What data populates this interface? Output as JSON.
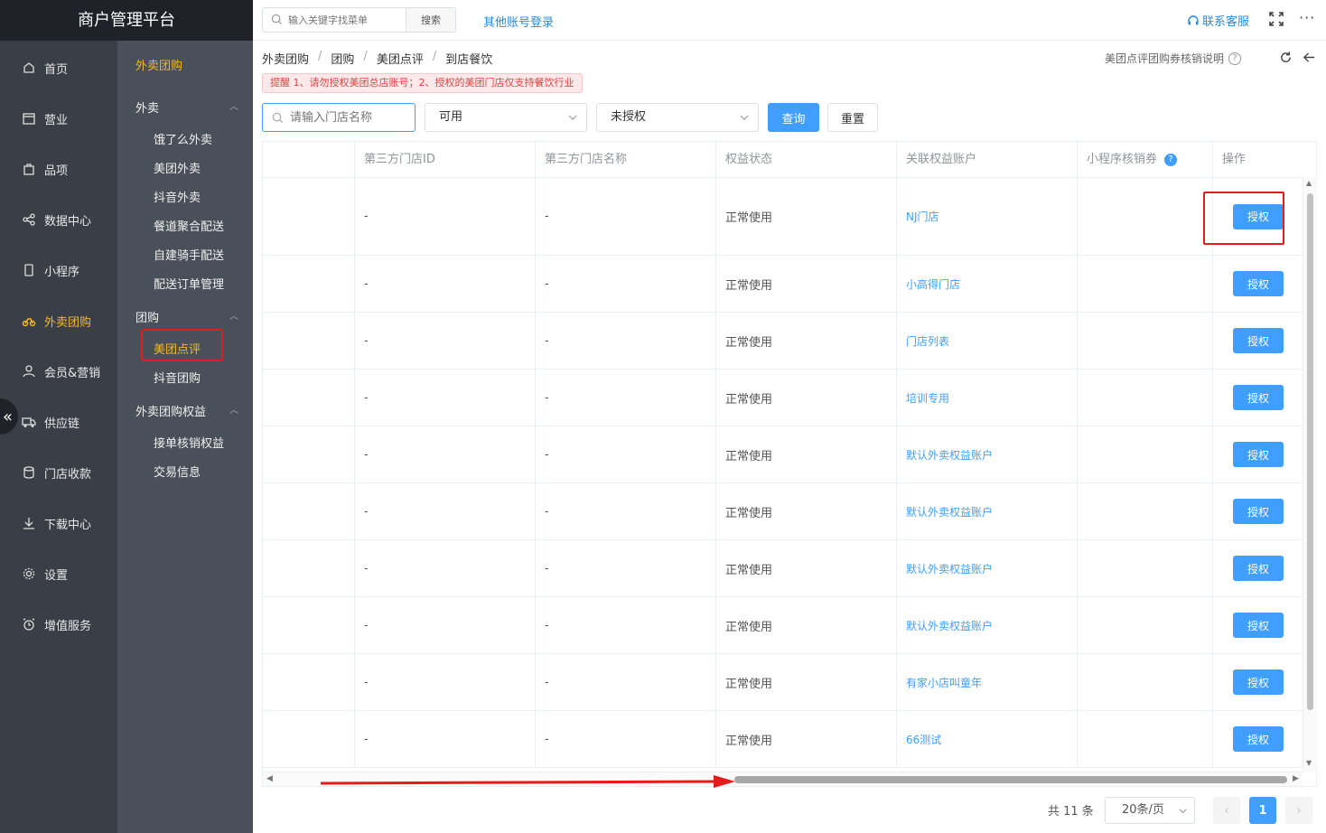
{
  "app": {
    "title": "商户管理平台"
  },
  "main_nav": [
    {
      "label": "首页",
      "icon": "home-icon"
    },
    {
      "label": "营业",
      "icon": "calendar-icon"
    },
    {
      "label": "品项",
      "icon": "bag-icon"
    },
    {
      "label": "数据中心",
      "icon": "share-icon"
    },
    {
      "label": "小程序",
      "icon": "phone-icon"
    },
    {
      "label": "外卖团购",
      "icon": "bike-icon",
      "active": true
    },
    {
      "label": "会员&营销",
      "icon": "user-icon"
    },
    {
      "label": "供应链",
      "icon": "truck-icon"
    },
    {
      "label": "门店收款",
      "icon": "coins-icon"
    },
    {
      "label": "下载中心",
      "icon": "download-icon"
    },
    {
      "label": "设置",
      "icon": "gear-icon"
    },
    {
      "label": "增值服务",
      "icon": "alarm-icon"
    }
  ],
  "sub_nav": {
    "title": "外卖团购",
    "group_waimai": "外卖",
    "waimai_items": [
      "饿了么外卖",
      "美团外卖",
      "抖音外卖",
      "餐道聚合配送",
      "自建骑手配送",
      "配送订单管理"
    ],
    "group_tuangou": "团购",
    "tuangou_items": [
      "美团点评",
      "抖音团购"
    ],
    "group_quanyi": "外卖团购权益",
    "quanyi_items": [
      "接单核销权益",
      "交易信息"
    ]
  },
  "topbar": {
    "search_placeholder": "输入关键字找菜单",
    "search_button": "搜索",
    "other_login": "其他账号登录",
    "contact": "联系客服",
    "more": "···"
  },
  "breadcrumb": [
    "外卖团购",
    "团购",
    "美团点评",
    "到店餐饮"
  ],
  "explain_link": "美团点评团购券核销说明",
  "notice": "提醒 1、请勿授权美团总店账号；2、授权的美团门店仅支持餐饮行业",
  "filters": {
    "store_placeholder": "请输入门店名称",
    "status_value": "可用",
    "auth_value": "未授权",
    "query_button": "查询",
    "reset_button": "重置"
  },
  "table": {
    "columns": [
      "",
      "第三方门店ID",
      "第三方门店名称",
      "权益状态",
      "关联权益账户",
      "小程序核销券",
      "操作"
    ],
    "help_mark": "?",
    "rows": [
      {
        "id": "-",
        "name": "-",
        "status": "正常使用",
        "account": "NJ门店",
        "action": "授权"
      },
      {
        "id": "-",
        "name": "-",
        "status": "正常使用",
        "account": "小高得门店",
        "action": "授权"
      },
      {
        "id": "-",
        "name": "-",
        "status": "正常使用",
        "account": "门店列表",
        "action": "授权"
      },
      {
        "id": "-",
        "name": "-",
        "status": "正常使用",
        "account": "培训专用",
        "action": "授权"
      },
      {
        "id": "-",
        "name": "-",
        "status": "正常使用",
        "account": "默认外卖权益账户",
        "action": "授权"
      },
      {
        "id": "-",
        "name": "-",
        "status": "正常使用",
        "account": "默认外卖权益账户",
        "action": "授权"
      },
      {
        "id": "-",
        "name": "-",
        "status": "正常使用",
        "account": "默认外卖权益账户",
        "action": "授权"
      },
      {
        "id": "-",
        "name": "-",
        "status": "正常使用",
        "account": "默认外卖权益账户",
        "action": "授权"
      },
      {
        "id": "-",
        "name": "-",
        "status": "正常使用",
        "account": "有家小店叫童年",
        "action": "授权"
      },
      {
        "id": "-",
        "name": "-",
        "status": "正常使用",
        "account": "66测试",
        "action": "授权"
      }
    ]
  },
  "pagination": {
    "total": "共 11 条",
    "page_size": "20条/页",
    "current": "1",
    "prev": "‹",
    "next": "›"
  },
  "colors": {
    "primary": "#409eff",
    "accent": "#f5b72b",
    "annotation": "#e51c1c",
    "sidebar": "#3a3f47"
  }
}
